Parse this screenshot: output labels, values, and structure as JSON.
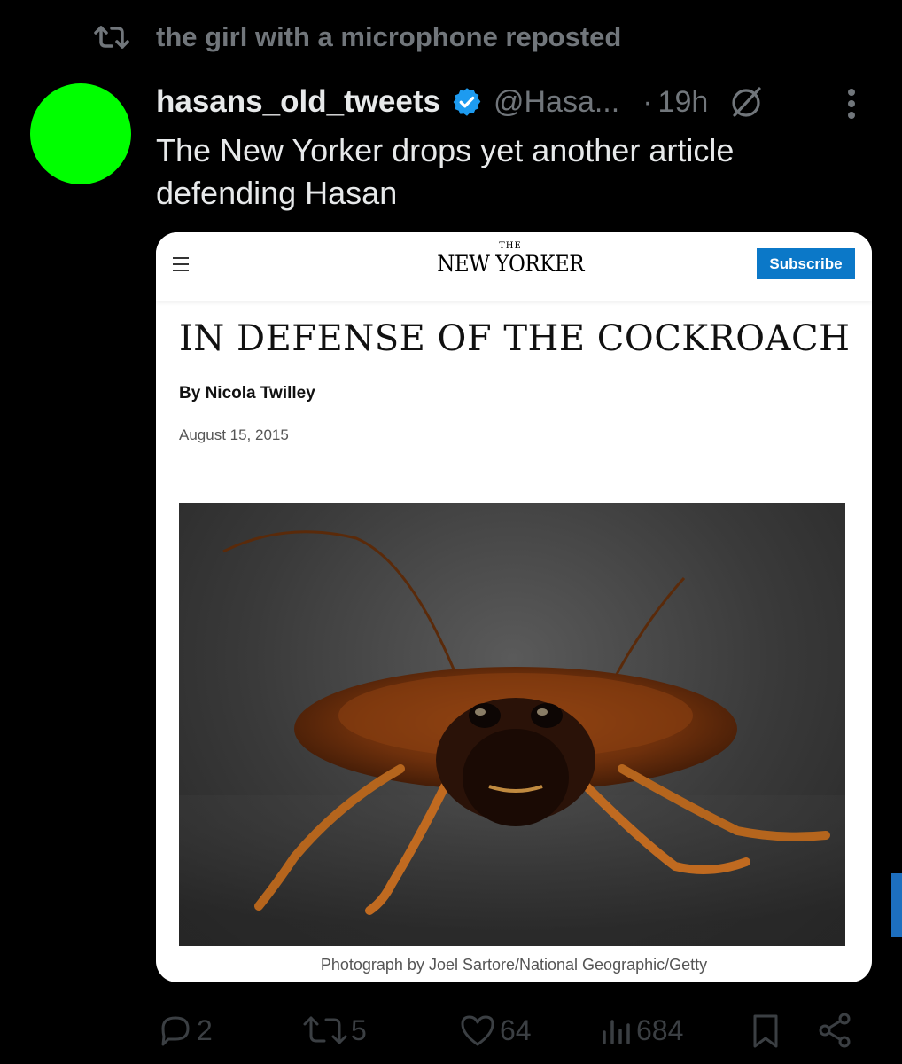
{
  "repost": {
    "text": "the girl with a microphone reposted",
    "icon": "repost-icon"
  },
  "tweet": {
    "display_name": "hasans_old_tweets",
    "verified": true,
    "handle": "@Hasa...",
    "separator": "·",
    "time": "19h",
    "text": "The New Yorker drops yet another article defending Hasan",
    "avatar_color": "#00ff00"
  },
  "card": {
    "logo_the": "THE",
    "logo_main": "NEW YORKER",
    "subscribe_label": "Subscribe",
    "title": "IN DEFENSE OF THE COCKROACH",
    "byline": "By Nicola Twilley",
    "date": "August 15, 2015",
    "caption": "Photograph by Joel Sartore/National Geographic/Getty"
  },
  "actions": {
    "replies": "2",
    "reposts": "5",
    "likes": "64",
    "views": "684"
  },
  "colors": {
    "background": "#000000",
    "muted": "#71767b",
    "text": "#e7e9ea",
    "verified": "#1d9bf0",
    "subscribe": "#0b78c8"
  }
}
